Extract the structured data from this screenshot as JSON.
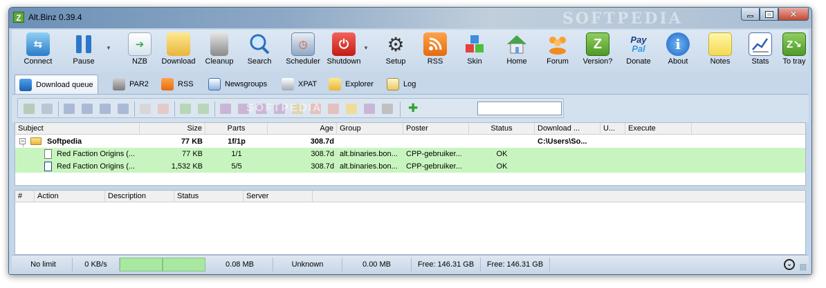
{
  "window": {
    "title": "Alt.Binz 0.39.4",
    "watermark": "SOFTPEDIA"
  },
  "toolbar": {
    "items": [
      {
        "label": "Connect",
        "icon": "connect-icon"
      },
      {
        "label": "Pause",
        "icon": "pause-icon"
      },
      {
        "label": "NZB",
        "icon": "nzb-icon"
      },
      {
        "label": "Download",
        "icon": "folder-icon"
      },
      {
        "label": "Cleanup",
        "icon": "trash-icon"
      },
      {
        "label": "Search",
        "icon": "search-icon"
      },
      {
        "label": "Scheduler",
        "icon": "calendar-clock-icon"
      },
      {
        "label": "Shutdown",
        "icon": "power-icon"
      },
      {
        "label": "Setup",
        "icon": "gear-icon"
      },
      {
        "label": "RSS",
        "icon": "rss-icon"
      },
      {
        "label": "Skin",
        "icon": "skin-cubes-icon"
      },
      {
        "label": "Home",
        "icon": "home-icon"
      },
      {
        "label": "Forum",
        "icon": "forum-people-icon"
      },
      {
        "label": "Version?",
        "icon": "version-z-icon"
      },
      {
        "label": "Donate",
        "icon": "paypal-icon"
      },
      {
        "label": "About",
        "icon": "info-icon"
      },
      {
        "label": "Notes",
        "icon": "notes-icon"
      },
      {
        "label": "Stats",
        "icon": "stats-chart-icon"
      },
      {
        "label": "To tray",
        "icon": "tray-icon"
      }
    ]
  },
  "tabs": [
    {
      "label": "Download queue",
      "active": true
    },
    {
      "label": "PAR2"
    },
    {
      "label": "RSS"
    },
    {
      "label": "Newsgroups"
    },
    {
      "label": "XPAT"
    },
    {
      "label": "Explorer"
    },
    {
      "label": "Log"
    }
  ],
  "toolbar2": {
    "watermark": "SOFTPEDIA",
    "filter_value": ""
  },
  "queue": {
    "columns": [
      "Subject",
      "Size",
      "Parts",
      "Age",
      "Group",
      "Poster",
      "Status",
      "Download ...",
      "U...",
      "Execute"
    ],
    "group_row": {
      "subject": "Softpedia",
      "size": "77 KB",
      "parts": "1f/1p",
      "age": "308.7d",
      "download": "C:\\Users\\So..."
    },
    "rows": [
      {
        "subject": "Red Faction Origins (...",
        "size": "77 KB",
        "parts": "1/1",
        "age": "308.7d",
        "group": "alt.binaries.bon...",
        "poster": "CPP-gebruiker...",
        "status": "OK"
      },
      {
        "subject": "Red Faction Origins (...",
        "size": "1,532 KB",
        "parts": "5/5",
        "age": "308.7d",
        "group": "alt.binaries.bon...",
        "poster": "CPP-gebruiker...",
        "status": "OK"
      }
    ]
  },
  "log": {
    "columns": [
      "#",
      "Action",
      "Description",
      "Status",
      "Server"
    ]
  },
  "status": {
    "limit": "No limit",
    "speed": "0 KB/s",
    "queue_size": "0.08 MB",
    "eta": "Unknown",
    "downloaded": "0.00 MB",
    "free1": "Free: 146.31 GB",
    "free2": "Free: 146.31 GB"
  },
  "colors": {
    "ok_row": "#c8f5bf",
    "progress": "#a8e8a0"
  }
}
